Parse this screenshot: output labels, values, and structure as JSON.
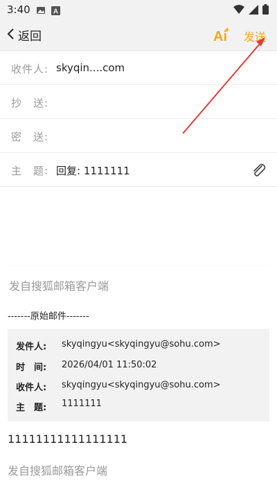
{
  "status_bar": {
    "time": "3:40"
  },
  "navbar": {
    "back_label": "返回",
    "send_label": "发送"
  },
  "form": {
    "to_label": "收件人:",
    "to_value": "skyqin....com",
    "cc_label": "抄　送:",
    "bcc_label": "密　送:",
    "subject_label": "主　题:",
    "subject_value": "回复: 1111111"
  },
  "signature": "发自搜狐邮箱客户端",
  "original": {
    "divider": "-------原始邮件-------",
    "from_label": "发件人:",
    "from_value": "skyqingyu<skyqingyu@sohu.com>",
    "time_label": "时　间:",
    "time_value": "2026/04/01 11:50:02",
    "to_label": "收件人:",
    "to_value": "skyqingyu<skyqingyu@sohu.com>",
    "subject_label": "主　题:",
    "subject_value": "1111111"
  },
  "quoted_body": "11111111111111111",
  "signature2": "发自搜狐邮箱客户端",
  "colors": {
    "accent": "#f5a623",
    "annotation": "#e53935"
  }
}
